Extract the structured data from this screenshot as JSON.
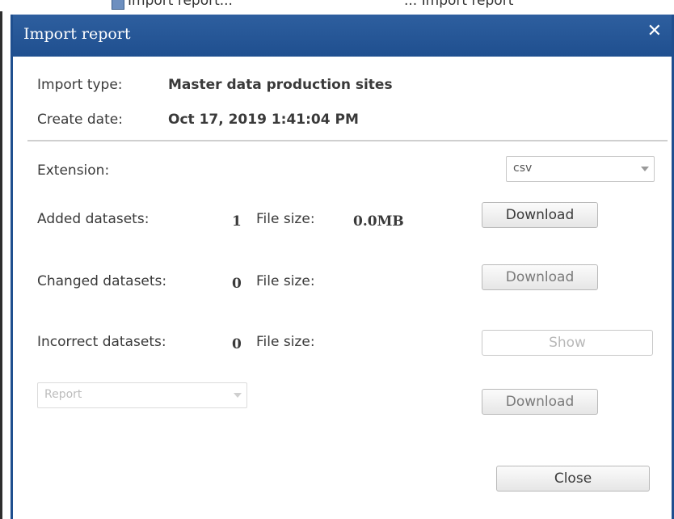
{
  "background": {
    "menu_item": "Import report...",
    "text_right": "... Import report"
  },
  "dialog": {
    "title": "Import report",
    "close_glyph": "✕"
  },
  "info": {
    "import_type_label": "Import type:",
    "import_type_value": "Master data production sites",
    "create_date_label": "Create date:",
    "create_date_value": "Oct 17, 2019 1:41:04 PM"
  },
  "extension": {
    "label": "Extension:",
    "selected": "csv"
  },
  "rows": {
    "added": {
      "label": "Added datasets:",
      "count": "1",
      "file_size_label": "File size:",
      "file_size_value": "0.0MB",
      "button": "Download"
    },
    "changed": {
      "label": "Changed datasets:",
      "count": "0",
      "file_size_label": "File size:",
      "file_size_value": "",
      "button": "Download"
    },
    "incorrect": {
      "label": "Incorrect datasets:",
      "count": "0",
      "file_size_label": "File size:",
      "file_size_value": "",
      "button": "Show"
    }
  },
  "report": {
    "placeholder": "Report",
    "button": "Download"
  },
  "footer": {
    "close_label": "Close"
  },
  "colors": {
    "titlebar": "#1f4f8f",
    "text": "#3a3a3a"
  }
}
